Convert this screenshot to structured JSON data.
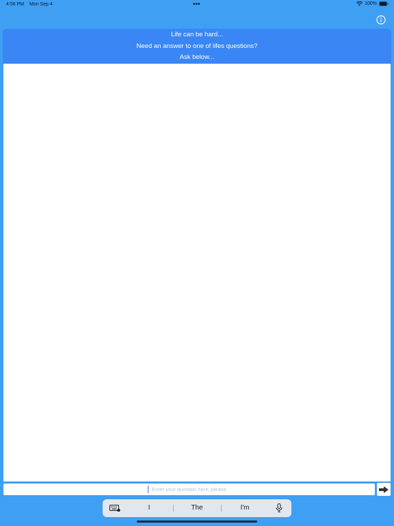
{
  "status_bar": {
    "time": "4:56 PM",
    "date": "Mon Sep 4",
    "battery": "100%"
  },
  "icons": {
    "info": "info-icon",
    "wifi": "wifi-icon",
    "battery": "battery-icon",
    "send": "arrow-right-icon",
    "keyboard": "keyboard-icon",
    "mic": "microphone-icon"
  },
  "header": {
    "line1": "Life can be hard...",
    "line2": "Need an answer to one of lifes questions?",
    "line3": "Ask below..."
  },
  "question": {
    "placeholder": "Enter your question here, please",
    "value": ""
  },
  "keyboard_suggestions": [
    "I",
    "The",
    "I'm"
  ],
  "colors": {
    "background": "#3f9ff3",
    "banner": "#3a86f5"
  }
}
